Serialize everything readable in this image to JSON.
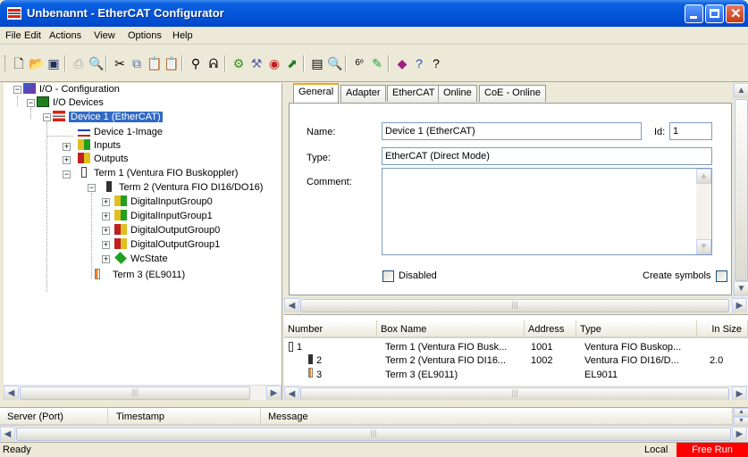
{
  "window": {
    "title": "Unbenannt - EtherCAT Configurator"
  },
  "menu": [
    "File",
    "Edit",
    "Actions",
    "View",
    "Options",
    "Help"
  ],
  "tree": {
    "root": "I/O - Configuration",
    "io_devices": "I/O Devices",
    "device1": "Device 1 (EtherCAT)",
    "device1_image": "Device 1-Image",
    "inputs": "Inputs",
    "outputs": "Outputs",
    "term1": "Term 1 (Ventura FIO Buskoppler)",
    "term2": "Term 2 (Ventura FIO DI16/DO16)",
    "dig_in0": "DigitalInputGroup0",
    "dig_in1": "DigitalInputGroup1",
    "dig_out0": "DigitalOutputGroup0",
    "dig_out1": "DigitalOutputGroup1",
    "wcstate": "WcState",
    "term3": "Term 3 (EL9011)"
  },
  "tabs": [
    "General",
    "Adapter",
    "EtherCAT",
    "Online",
    "CoE - Online"
  ],
  "general": {
    "name_label": "Name:",
    "name_value": "Device 1 (EtherCAT)",
    "id_label": "Id:",
    "id_value": "1",
    "type_label": "Type:",
    "type_value": "EtherCAT (Direct Mode)",
    "comment_label": "Comment:",
    "comment_value": "",
    "disabled_label": "Disabled",
    "create_symbols_label": "Create symbols"
  },
  "device_list": {
    "columns": [
      "Number",
      "Box Name",
      "Address",
      "Type",
      "In Size"
    ],
    "rows": [
      {
        "number": "1",
        "box": "Term 1 (Ventura FIO Busk...",
        "address": "1001",
        "type": "Ventura FIO Buskop...",
        "insize": ""
      },
      {
        "number": "2",
        "box": "Term 2 (Ventura FIO DI16...",
        "address": "1002",
        "type": "Ventura FIO DI16/D...",
        "insize": "2.0"
      },
      {
        "number": "3",
        "box": "Term 3 (EL9011)",
        "address": "",
        "type": "EL9011",
        "insize": ""
      }
    ]
  },
  "log": {
    "columns": [
      "Server (Port)",
      "Timestamp",
      "Message"
    ]
  },
  "status": {
    "left": "Ready",
    "local": "Local",
    "mode": "Free Run",
    "mode_color": "#ff0000"
  }
}
